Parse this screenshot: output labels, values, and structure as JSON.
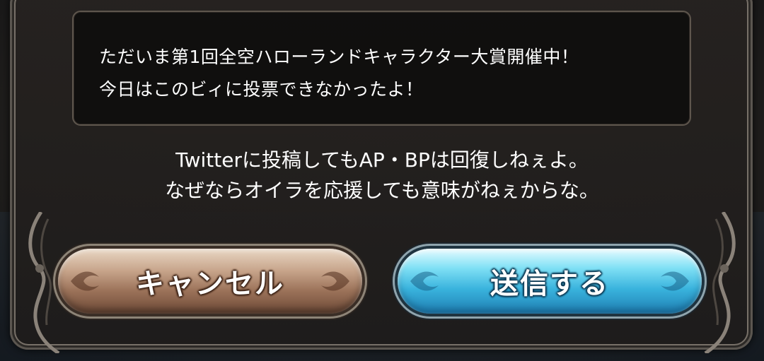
{
  "dialog": {
    "message_lines": [
      "ただいま第1回全空ハローランドキャラクター大賞開催中！",
      "今日はこのビィに投票できなかったよ！"
    ],
    "notice_lines": [
      "Twitterに投稿してもAP・BPは回復しねぇよ。",
      "なぜならオイラを応援しても意味がねぇからな。"
    ]
  },
  "buttons": {
    "cancel_label": "キャンセル",
    "send_label": "送信する"
  },
  "colors": {
    "cancel_button": "#a77b62",
    "send_button": "#4ec3e6",
    "frame": "#5b5650",
    "text": "#ffffff"
  }
}
